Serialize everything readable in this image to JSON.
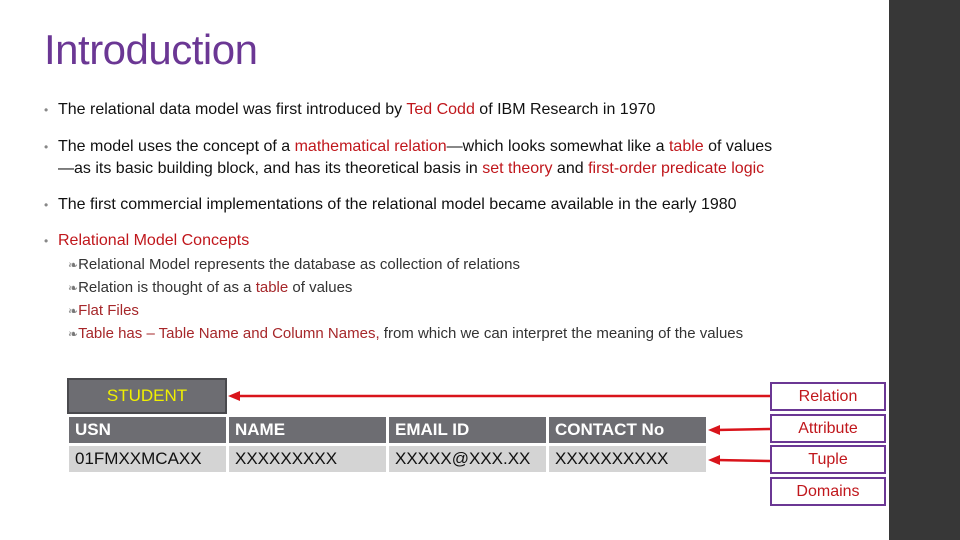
{
  "slide": {
    "title": "Introduction",
    "bullets": [
      {
        "parts": [
          "The relational data model was first introduced by ",
          "Ted Codd",
          " of IBM Research in 1970"
        ]
      },
      {
        "line1": [
          "The model uses the concept of a ",
          "mathematical relation",
          "—which looks somewhat like a ",
          "table",
          " of values"
        ],
        "line2": [
          "—as its basic building block, and has its theoretical basis in ",
          "set theory",
          " and ",
          "first-order predicate logic"
        ]
      },
      {
        "parts": [
          "The first commercial implementations of the relational model became available in the early 1980"
        ]
      },
      {
        "parts": [
          "Relational Model Concepts"
        ]
      }
    ],
    "sub_bullets": [
      {
        "parts": [
          "Relational Model represents the database as collection of relations"
        ]
      },
      {
        "parts": [
          "Relation is thought of as a ",
          "table",
          " of values"
        ]
      },
      {
        "parts": [
          "Flat Files"
        ]
      },
      {
        "parts": [
          "Table has – Table Name and Column Names,",
          " from which we can interpret the meaning of the values"
        ]
      }
    ],
    "sub_bullet_glyph": "❧",
    "bullet_glyph": "•"
  },
  "diagram": {
    "table_name": "STUDENT",
    "columns": [
      "USN",
      "NAME",
      "EMAIL ID",
      "CONTACT No"
    ],
    "row": [
      "01FMXXMCAXX",
      "XXXXXXXXX",
      "XXXXX@XXX.XX",
      "XXXXXXXXXX"
    ],
    "labels": [
      "Relation",
      "Attribute",
      "Tuple",
      "Domains"
    ],
    "colors": {
      "accent_purple": "#6b3794",
      "arrow_red": "#d9141b",
      "header_gray": "#6d6d72",
      "row_gray": "#d4d4d4",
      "table_name_yellow": "#f0f000"
    }
  }
}
